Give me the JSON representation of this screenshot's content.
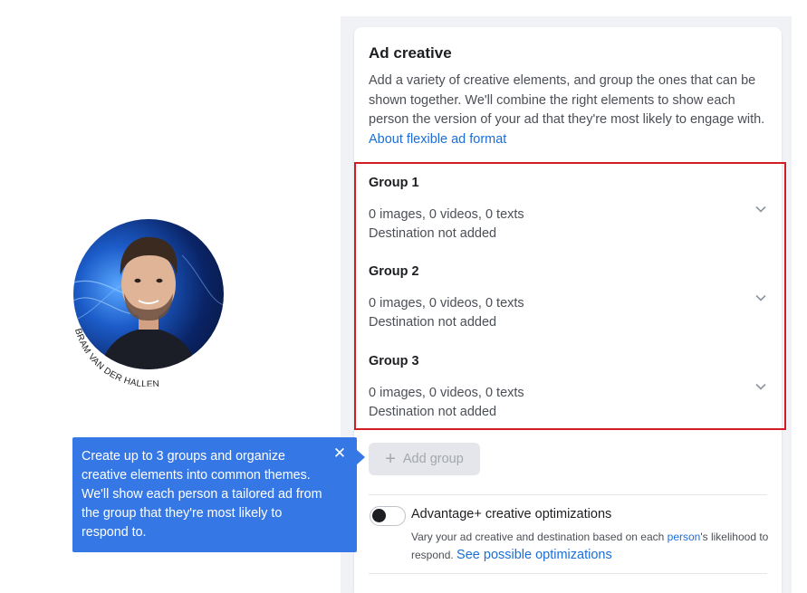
{
  "card": {
    "title": "Ad creative",
    "description": "Add a variety of creative elements, and group the ones that can be shown together. We'll combine the right elements to show each person the version of your ad that they're most likely to engage with.",
    "link_label": "About flexible ad format"
  },
  "groups": [
    {
      "title": "Group 1",
      "summary": "0 images, 0 videos, 0 texts",
      "destination": "Destination not added"
    },
    {
      "title": "Group 2",
      "summary": "0 images, 0 videos, 0 texts",
      "destination": "Destination not added"
    },
    {
      "title": "Group 3",
      "summary": "0 images, 0 videos, 0 texts",
      "destination": "Destination not added"
    }
  ],
  "add_group": {
    "label": "Add group",
    "icon": "plus-icon"
  },
  "advantage": {
    "title": "Advantage+ creative optimizations",
    "desc_part1": "Vary your ad creative and destination based on each ",
    "desc_link1": "person",
    "desc_part2": "'s likelihood to respond. ",
    "desc_link2": "See possible optimizations",
    "toggle_state": "off"
  },
  "tooltip": {
    "text": "Create up to 3 groups and organize creative elements into common themes. We'll show each person a tailored ad from the group that they're most likely to respond to.",
    "close_icon": "close-icon"
  },
  "avatar": {
    "caption": "BRAM VAN DER HALLEN"
  },
  "colors": {
    "accent": "#3578e5",
    "link": "#1a6ed8",
    "highlight_border": "#d31b24"
  }
}
